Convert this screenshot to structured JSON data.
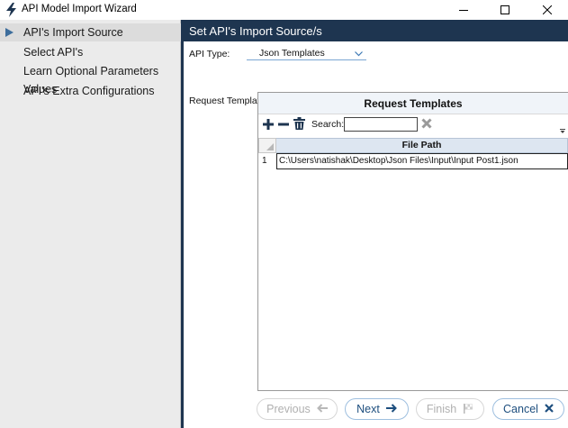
{
  "window": {
    "title": "API Model Import Wizard",
    "icon": "lightning-bolt-icon",
    "controls": [
      "minimize-icon",
      "maximize-icon",
      "close-icon"
    ]
  },
  "sidebar": {
    "items": [
      {
        "label": "API's Import Source",
        "active": true
      },
      {
        "label": "Select API's",
        "active": false
      },
      {
        "label": "Learn Optional Parameters Values",
        "active": false
      },
      {
        "label": "API's Extra Configurations",
        "active": false
      }
    ]
  },
  "main": {
    "header": "Set API's Import Source/s",
    "api_type_label": "API Type:",
    "api_type_value": "Json Templates",
    "request_templates_label": "Request Templates:",
    "panel": {
      "title": "Request Templates",
      "toolbar": {
        "add_icon": "plus-icon",
        "remove_icon": "minus-icon",
        "delete_icon": "trash-icon",
        "search_label": "Search:",
        "search_value": "",
        "clear_icon": "x-icon"
      },
      "grid": {
        "columns": [
          "File Path"
        ],
        "rows": [
          {
            "num": "1",
            "file_path": "C:\\Users\\natishak\\Desktop\\Json Files\\Input\\Input Post1.json"
          }
        ]
      }
    }
  },
  "footer": {
    "previous": "Previous",
    "next": "Next",
    "finish": "Finish",
    "cancel": "Cancel"
  },
  "colors": {
    "header_bg": "#1e3550",
    "accent": "#1d4e7e",
    "sidebar_bg": "#ebebeb"
  }
}
